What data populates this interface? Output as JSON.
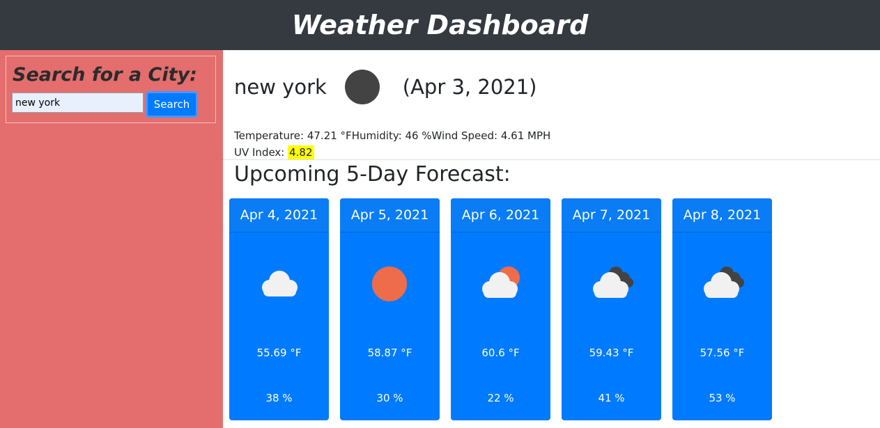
{
  "header": {
    "title": "Weather Dashboard"
  },
  "sidebar": {
    "search_title": "Search for a City:",
    "search_value": "new york",
    "search_button": "Search"
  },
  "current": {
    "city": "new york",
    "icon": "dark-circle-icon",
    "date": "(Apr 3, 2021)",
    "temperature_label": "Temperature: ",
    "temperature": "47.21 °F",
    "humidity_label": "Humidity: ",
    "humidity": "46 %",
    "wind_label": "Wind Speed: ",
    "wind": "4.61 MPH",
    "uv_label": "UV Index: ",
    "uv": "4.82",
    "uv_color": "#ffff00"
  },
  "forecast": {
    "title": "Upcoming 5-Day Forecast:",
    "card_color": "#007bff",
    "days": [
      {
        "date": "Apr 4, 2021",
        "icon": "cloud-icon",
        "temp": "55.69 °F",
        "humidity": "38 %"
      },
      {
        "date": "Apr 5, 2021",
        "icon": "sun-icon",
        "temp": "58.87 °F",
        "humidity": "30 %"
      },
      {
        "date": "Apr 6, 2021",
        "icon": "partly-cloudy-icon",
        "temp": "60.6 °F",
        "humidity": "22 %"
      },
      {
        "date": "Apr 7, 2021",
        "icon": "broken-clouds-icon",
        "temp": "59.43 °F",
        "humidity": "41 %"
      },
      {
        "date": "Apr 8, 2021",
        "icon": "broken-clouds-icon",
        "temp": "57.56 °F",
        "humidity": "53 %"
      }
    ]
  }
}
